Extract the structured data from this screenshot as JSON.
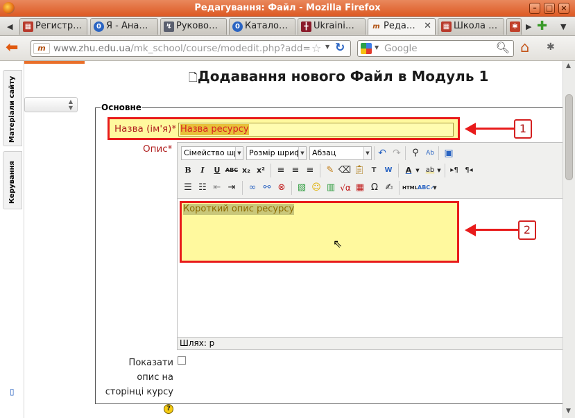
{
  "window": {
    "title": "Редагування: Файл - Mozilla Firefox",
    "buttons": {
      "minimize": "–",
      "maximize": "□",
      "close": "×"
    }
  },
  "tabs": [
    {
      "label": "Регистр…",
      "icon": "ua"
    },
    {
      "label": "Я - Ана…",
      "icon": "o"
    },
    {
      "label": "Руково…",
      "icon": "tool"
    },
    {
      "label": "Катало…",
      "icon": "o"
    },
    {
      "label": "Ukraini…",
      "icon": "flag"
    },
    {
      "label": "Реда…",
      "icon": "moodle",
      "active": true
    },
    {
      "label": "Школа …",
      "icon": "ua"
    }
  ],
  "navbar": {
    "url_prefix": "www.zhu.edu.ua",
    "url_rest": "/mk_school/course/modedit.php?add=",
    "search_placeholder": "Google"
  },
  "left_dock": {
    "tab1": "Матеріали сайту",
    "tab2": "Керування"
  },
  "page": {
    "title": "Додавання нового Файл в Модуль 1",
    "legend": "Основне",
    "name_label": "Назва (ім'я)",
    "required_mark": "*",
    "name_value": "Назва ресурсу",
    "desc_label": "Опис",
    "desc_value": "Короткий опис ресурсу",
    "path_label": "Шлях: p",
    "show_desc_label": "Показати опис на сторінці курсу",
    "help": "?"
  },
  "editor_toolbar": {
    "font_family": "Сімейство шр",
    "font_size": "Розмір шрифт",
    "format": "Абзац"
  },
  "callouts": {
    "one": "1",
    "two": "2"
  },
  "colors": {
    "highlight_border": "#e81b1b",
    "highlight_fill": "#fff99e",
    "titlebar": "#dd5a24"
  }
}
